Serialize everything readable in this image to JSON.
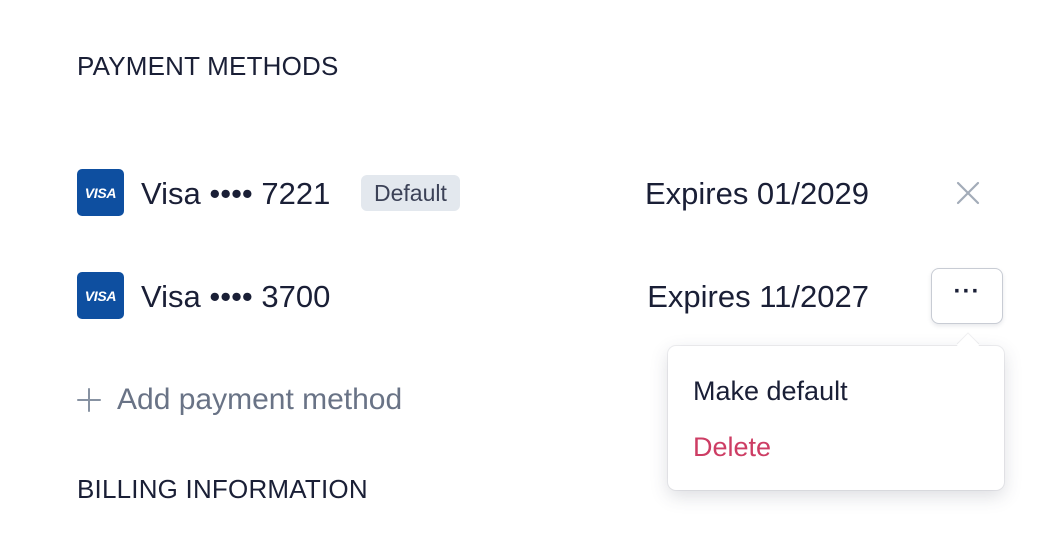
{
  "payment_methods": {
    "title": "PAYMENT METHODS",
    "cards": [
      {
        "brand_logo": "VISA",
        "label": "Visa •••• 7221",
        "badge": "Default",
        "expires": "Expires 01/2029",
        "action_icon": "close-icon"
      },
      {
        "brand_logo": "VISA",
        "label": "Visa •••• 3700",
        "expires": "Expires 11/2027",
        "action_icon": "more-icon",
        "action_label": "···"
      }
    ],
    "add_label": "Add payment method",
    "add_icon": "plus-icon"
  },
  "dropdown_menu": {
    "items": [
      {
        "label": "Make default"
      },
      {
        "label": "Delete",
        "color": "#cd3d64"
      }
    ]
  },
  "billing_information": {
    "title": "BILLING INFORMATION"
  },
  "colors": {
    "visa_brand": "#0e4fa0",
    "text_primary": "#1a1f36",
    "text_muted": "#697386",
    "badge_bg": "#e3e8ee",
    "danger": "#cd3d64"
  }
}
